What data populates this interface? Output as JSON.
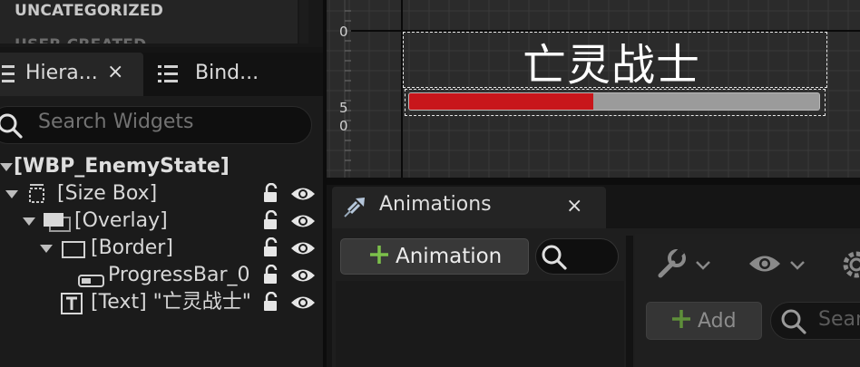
{
  "palette": {
    "categories": [
      "UNCATEGORIZED",
      "USER CREATED"
    ]
  },
  "tabs": {
    "hierarchy": "Hiera...",
    "bind_widgets": "Bind...",
    "close_glyph": "×"
  },
  "hierarchy": {
    "search_placeholder": "Search Widgets",
    "root": "[WBP_EnemyState]",
    "nodes": [
      {
        "label": "[Size Box]"
      },
      {
        "label": "[Overlay]"
      },
      {
        "label": "[Border]"
      },
      {
        "label": "ProgressBar_0"
      },
      {
        "label": "[Text] \"亡灵战士\""
      }
    ]
  },
  "designer": {
    "ruler_labels": [
      "0",
      "5",
      "0"
    ],
    "widget_text": "亡灵战士",
    "progress_percent": 45,
    "progress_fill_color": "#c8161b",
    "progress_back_color": "#9b9b9b"
  },
  "animations": {
    "tab_title": "Animations",
    "close_glyph": "×",
    "add_button": "Animation",
    "accent_color": "#7cc04a"
  },
  "right_pane": {
    "add_button": "Add",
    "search_placeholder": "Sear"
  }
}
